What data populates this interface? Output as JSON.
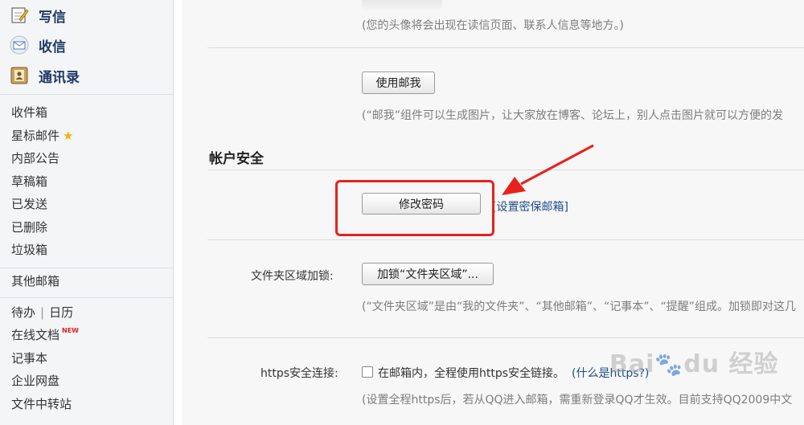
{
  "sidebar": {
    "compose_label": "写信",
    "inbox_label": "收信",
    "contacts_label": "通讯录",
    "folders": [
      "收件箱",
      "星标邮件",
      "内部公告",
      "草稿箱",
      "已发送",
      "已删除",
      "垃圾箱"
    ],
    "other_mail": "其他邮箱",
    "todo": "待办",
    "calendar": "日历",
    "online_doc": "在线文档",
    "new_badge": "NEW",
    "notes": "记事本",
    "enterprise_disk": "企业网盘",
    "file_transfer": "文件中转站"
  },
  "content": {
    "avatar_note": "(您的头像将会出现在读信页面、联系人信息等地方。)",
    "mailme_button": "使用邮我",
    "mailme_note": "(“邮我”组件可以生成图片，让大家放在博客、论坛上，别人点击图片就可以方便的发",
    "security_title": "帐户安全",
    "change_password_button": "修改密码",
    "set_security_email_link": "[设置密保邮箱]",
    "folder_lock_label": "文件夹区域加锁:",
    "folder_lock_button": "加锁“文件夹区域”...",
    "folder_lock_note": "(“文件夹区域”是由“我的文件夹”、“其他邮箱”、“记事本”、“提醒”组成。加锁即对这几",
    "https_label": "https安全连接:",
    "https_checkbox_label": "在邮箱内，全程使用https安全链接。",
    "https_what_link": "(什么是https?)",
    "https_note": "(设置全程https后，若从QQ进入邮箱，需重新登录QQ才生效。目前支持QQ2009中文"
  },
  "watermark_text": "Bai",
  "watermark_text2": "du 经验",
  "colors": {
    "highlight_box": "#e8211c",
    "arrow": "#e8211c",
    "link": "#1e4d8c"
  }
}
